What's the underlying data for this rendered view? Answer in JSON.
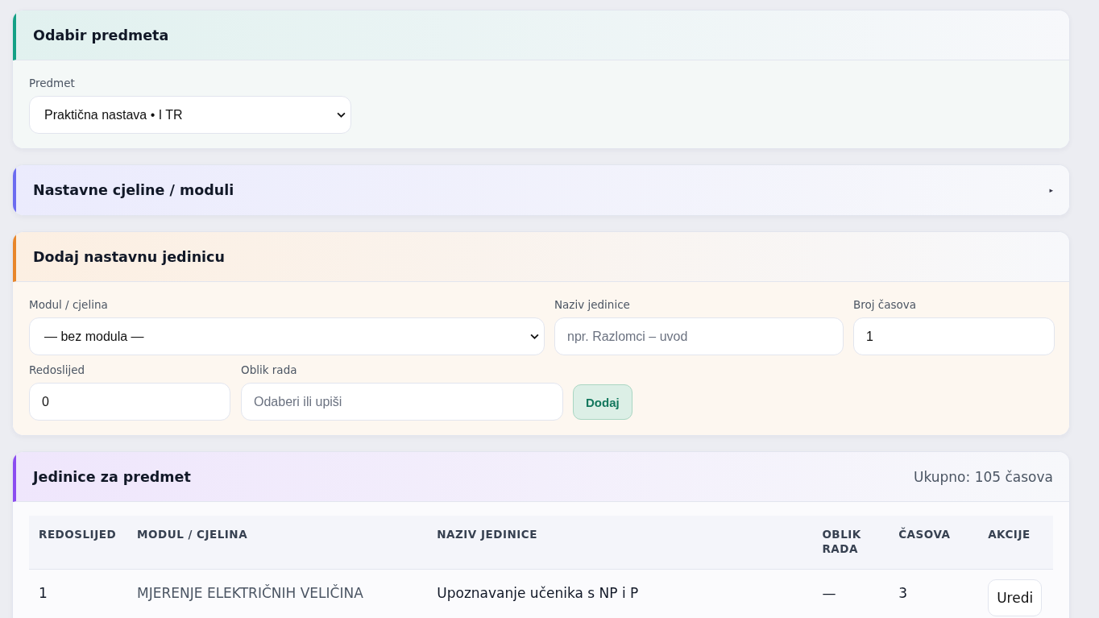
{
  "subject_card": {
    "title": "Odabir predmeta",
    "field_label": "Predmet",
    "select_value": "Praktična nastava • I TR"
  },
  "modules_card": {
    "title": "Nastavne cjeline / moduli",
    "expanded": false,
    "toggle": "▸"
  },
  "add_card": {
    "title": "Dodaj nastavnu jedinicu",
    "fields": [
      {
        "kind": "select",
        "label": "Modul / cjelina",
        "value": "— bez modula —"
      },
      {
        "kind": "input",
        "label": "Naziv jedinice",
        "placeholder": "npr. Razlomci – uvod"
      },
      {
        "kind": "input",
        "label": "Broj časova",
        "value": "1"
      },
      {
        "kind": "input",
        "label": "Redoslijed",
        "value": "0"
      },
      {
        "kind": "input",
        "label": "Oblik rada",
        "placeholder": "Odaberi ili upiši"
      }
    ],
    "button": "Dodaj"
  },
  "units_card": {
    "title": "Jedinice za predmet",
    "total": "Ukupno: 105 časova",
    "columns": [
      "REDOSLIJED",
      "MODUL / CJELINA",
      "NAZIV JEDINICE",
      "OBLIK RADA",
      "ČASOVA",
      "AKCIJE"
    ],
    "rows": [
      {
        "order": "1",
        "module": "MJERENJE ELEKTRIČNIH VELIČINA",
        "name": "Upoznavanje učenika s NP i P",
        "form": "—",
        "hours": "3",
        "action": "Uredi"
      }
    ]
  }
}
